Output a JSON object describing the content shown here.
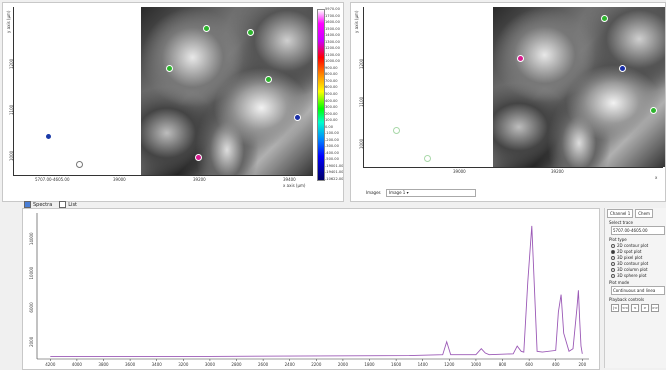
{
  "left_map": {
    "y_axis_label": "y axis (µm)",
    "y_ticks": [
      "1200",
      "1100",
      "1000"
    ],
    "x_ticks": [
      "5707.00-4605.00",
      "39000",
      "39200",
      "39400"
    ],
    "x_axis_label": "x axis (µm)",
    "colorbar_labels": [
      "5970.00",
      "1700.00",
      "1600.00",
      "1500.00",
      "1400.00",
      "1300.00",
      "1200.00",
      "1100.00",
      "1000.00",
      "900.00",
      "800.00",
      "700.00",
      "600.00",
      "500.00",
      "400.00",
      "300.00",
      "200.00",
      "100.00",
      "0.00",
      "-100.00",
      "-200.00",
      "-300.00",
      "-400.00",
      "-500.00",
      "-19001.00",
      "-19401.00",
      "-10622.00"
    ],
    "markers": [
      {
        "color": "#2db52d",
        "label": "green"
      },
      {
        "color": "#2db52d",
        "label": "green"
      },
      {
        "color": "#2db52d",
        "label": "green"
      },
      {
        "color": "#2db52d",
        "label": "green"
      },
      {
        "color": "#1a2fa8",
        "label": "blue"
      },
      {
        "color": "#d81b8f",
        "label": "magenta"
      },
      {
        "color": "#1a3aa8",
        "label": "blue"
      },
      {
        "color": "#ffffff",
        "label": "white"
      }
    ]
  },
  "right_map": {
    "y_axis_label": "y axis (µm)",
    "y_ticks": [
      "1200",
      "1100",
      "1000"
    ],
    "x_ticks": [
      "39000",
      "39200"
    ],
    "x_axis_label": "x",
    "images_label": "Images",
    "image_combo": "Image 1",
    "markers": [
      {
        "color": "#d81b8f"
      },
      {
        "color": "#1a2fa8"
      },
      {
        "color": "#2db52d"
      },
      {
        "color": "#2db52d"
      },
      {
        "color": "#a8d8a8"
      },
      {
        "color": "#a8d8a8"
      }
    ]
  },
  "spectra_tabs": [
    {
      "label": "Spectra",
      "checked": true
    },
    {
      "label": "List",
      "checked": false
    }
  ],
  "chart_data": {
    "type": "line",
    "title": "",
    "xlabel": "",
    "ylabel": "",
    "y_ticks": [
      2000,
      6000,
      10000,
      14000
    ],
    "x_ticks": [
      4200,
      4000,
      3800,
      3600,
      3400,
      3200,
      3000,
      2800,
      2600,
      2400,
      2200,
      2000,
      1800,
      1600,
      1400,
      1200,
      1000,
      800,
      600,
      400,
      200
    ],
    "x": [
      4200,
      3000,
      1500,
      1250,
      1220,
      1190,
      1000,
      960,
      930,
      900,
      720,
      690,
      660,
      640,
      610,
      580,
      540,
      500,
      400,
      380,
      360,
      340,
      300,
      270,
      240,
      230,
      220,
      210,
      200
    ],
    "y": [
      300,
      300,
      400,
      500,
      2000,
      500,
      500,
      1200,
      700,
      500,
      600,
      1500,
      900,
      800,
      9000,
      15500,
      900,
      800,
      1000,
      5500,
      7500,
      3000,
      900,
      1200,
      6000,
      8000,
      4500,
      1500,
      600
    ],
    "xlim": [
      4300,
      150
    ],
    "ylim": [
      0,
      17000
    ],
    "series_color": "#9b59b6"
  },
  "side_panel": {
    "tabs": [
      "Channel 1",
      "Chem"
    ],
    "select_trace_label": "Select trace",
    "trace_value": "5707.00-4605.00",
    "plot_type_label": "Plot type",
    "plot_types": [
      {
        "label": "2D contour plot",
        "selected": false
      },
      {
        "label": "2D spot plot",
        "selected": true
      },
      {
        "label": "3D pixel plot",
        "selected": false
      },
      {
        "label": "3D contour plot",
        "selected": false
      },
      {
        "label": "3D column plot",
        "selected": false
      },
      {
        "label": "3D sphere plot",
        "selected": false
      }
    ],
    "plot_mode_label": "Plot mode",
    "plot_mode_value": "Continuous and linea",
    "playback_label": "Playback controls",
    "playback_buttons": [
      "|<",
      "<<",
      "<",
      ">",
      ">>"
    ]
  }
}
